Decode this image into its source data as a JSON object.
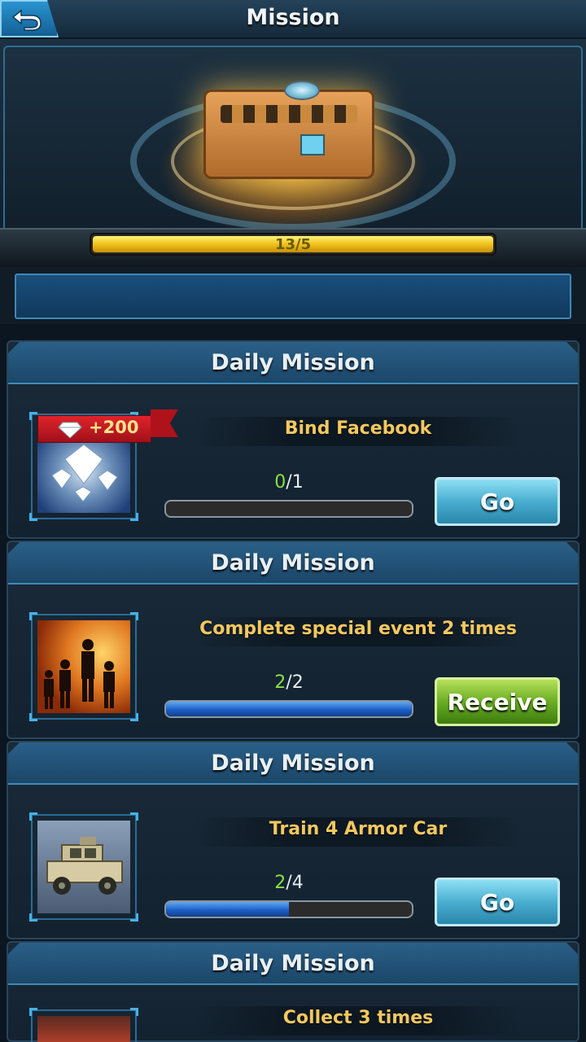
{
  "header": {
    "title": "Mission",
    "back_icon": "back-arrow-icon"
  },
  "hero": {
    "reward_icon": "supply-crate-icon",
    "progress_text": "13/5",
    "progress_fraction": 1.0,
    "progress_color": "#f0c21c"
  },
  "missions": [
    {
      "header": "Daily Mission",
      "image": "diamonds-image",
      "reward": "+200",
      "reward_icon": "diamond-icon",
      "task": "Bind Facebook",
      "done": "0",
      "total": "1",
      "progress_fraction": 0.0,
      "button": "Go",
      "button_type": "go"
    },
    {
      "header": "Daily Mission",
      "image": "soldiers-image",
      "task": "Complete special event 2 times",
      "done": "2",
      "total": "2",
      "progress_fraction": 1.0,
      "button": "Receive",
      "button_type": "receive"
    },
    {
      "header": "Daily Mission",
      "image": "armor-car-image",
      "task": "Train 4 Armor Car",
      "done": "2",
      "total": "4",
      "progress_fraction": 0.5,
      "button": "Go",
      "button_type": "go"
    },
    {
      "header": "Daily Mission",
      "image": "collect-image",
      "task": "Collect 3 times"
    }
  ],
  "colors": {
    "done_count": "#86e046",
    "task_name": "#f2c860",
    "go_button": "#4aaed0",
    "receive_button": "#6aae24"
  }
}
